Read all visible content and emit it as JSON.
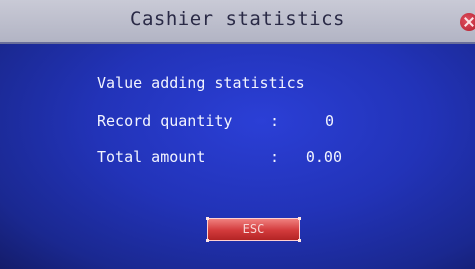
{
  "window": {
    "title": "Cashier statistics"
  },
  "statistics": {
    "section_title": "Value adding statistics",
    "rows": [
      {
        "label": "Record quantity",
        "colon": ":",
        "value": "0"
      },
      {
        "label": "Total amount",
        "colon": ":",
        "value": "0.00"
      }
    ]
  },
  "actions": {
    "esc_label": "ESC"
  },
  "colors": {
    "background": "#2233b8",
    "title_bar": "#c0c2d0",
    "button": "#d23a3b",
    "text": "#f2f4ff"
  },
  "icons": {
    "close": "close-icon"
  }
}
